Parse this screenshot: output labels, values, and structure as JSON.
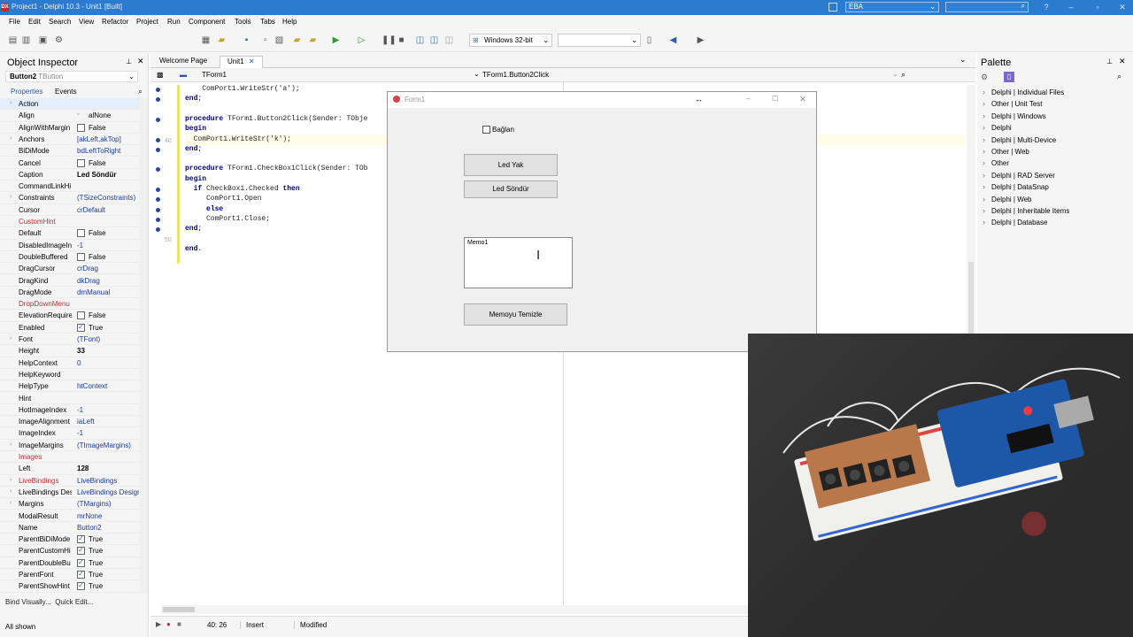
{
  "window": {
    "title": "Project1 - Delphi 10.3 - Unit1 [Built]",
    "app_badge": "DX",
    "desktop_combo": "EBA",
    "search_placeholder": ""
  },
  "menu": [
    "File",
    "Edit",
    "Search",
    "View",
    "Refactor",
    "Project",
    "Run",
    "Component",
    "Tools",
    "Tabs",
    "Help"
  ],
  "toolbar": {
    "platform": "Windows 32-bit",
    "config": ""
  },
  "object_inspector": {
    "title": "Object Inspector",
    "selected": "Button2",
    "selected_type": "TButton",
    "tabs": [
      "Properties",
      "Events"
    ],
    "properties": [
      {
        "name": "Action",
        "value": "",
        "exp": true,
        "style": "bold"
      },
      {
        "name": "Align",
        "value": "alNone"
      },
      {
        "name": "AlignWithMargin",
        "value": "False",
        "cb": false
      },
      {
        "name": "Anchors",
        "value": "[akLeft,akTop]",
        "exp": true
      },
      {
        "name": "BiDiMode",
        "value": "bdLeftToRight"
      },
      {
        "name": "Cancel",
        "value": "False",
        "cb": false
      },
      {
        "name": "Caption",
        "value": "Led Söndür",
        "vstyle": "bold"
      },
      {
        "name": "CommandLinkHi",
        "value": ""
      },
      {
        "name": "Constraints",
        "value": "(TSizeConstraints)",
        "exp": true
      },
      {
        "name": "Cursor",
        "value": "crDefault"
      },
      {
        "name": "CustomHint",
        "value": "",
        "nstyle": "red"
      },
      {
        "name": "Default",
        "value": "False",
        "cb": false
      },
      {
        "name": "DisabledImageIn",
        "value": "-1"
      },
      {
        "name": "DoubleBuffered",
        "value": "False",
        "cb": false
      },
      {
        "name": "DragCursor",
        "value": "crDrag"
      },
      {
        "name": "DragKind",
        "value": "dkDrag"
      },
      {
        "name": "DragMode",
        "value": "dmManual"
      },
      {
        "name": "DropDownMenu",
        "value": "",
        "nstyle": "red"
      },
      {
        "name": "ElevationRequire",
        "value": "False",
        "cb": false
      },
      {
        "name": "Enabled",
        "value": "True",
        "cb": true
      },
      {
        "name": "Font",
        "value": "(TFont)",
        "exp": true
      },
      {
        "name": "Height",
        "value": "33",
        "vstyle": "bold"
      },
      {
        "name": "HelpContext",
        "value": "0"
      },
      {
        "name": "HelpKeyword",
        "value": ""
      },
      {
        "name": "HelpType",
        "value": "htContext"
      },
      {
        "name": "Hint",
        "value": ""
      },
      {
        "name": "HotImageIndex",
        "value": "-1"
      },
      {
        "name": "ImageAlignment",
        "value": "iaLeft"
      },
      {
        "name": "ImageIndex",
        "value": "-1"
      },
      {
        "name": "ImageMargins",
        "value": "(TImageMargins)",
        "exp": true
      },
      {
        "name": "Images",
        "value": "",
        "nstyle": "red"
      },
      {
        "name": "Left",
        "value": "128",
        "vstyle": "bold"
      },
      {
        "name": "LiveBindings",
        "value": "LiveBindings",
        "exp": true,
        "nstyle": "red"
      },
      {
        "name": "LiveBindings Des",
        "value": "LiveBindings Design",
        "exp": true
      },
      {
        "name": "Margins",
        "value": "(TMargins)",
        "exp": true
      },
      {
        "name": "ModalResult",
        "value": "mrNone"
      },
      {
        "name": "Name",
        "value": "Button2"
      },
      {
        "name": "ParentBiDiMode",
        "value": "True",
        "cb": true
      },
      {
        "name": "ParentCustomHi",
        "value": "True",
        "cb": true
      },
      {
        "name": "ParentDoubleBu",
        "value": "True",
        "cb": true
      },
      {
        "name": "ParentFont",
        "value": "True",
        "cb": true
      },
      {
        "name": "ParentShowHint",
        "value": "True",
        "cb": true
      }
    ],
    "bind_visually": "Bind Visually...",
    "quick_edit": "Quick Edit...",
    "all_shown": "All shown"
  },
  "editor": {
    "tabs": [
      "Welcome Page",
      "Unit1"
    ],
    "class_combo": "TForm1",
    "method_combo": "TForm1.Button2Click",
    "line_number": "40",
    "line_number_50": "50",
    "status": {
      "pos": "40: 26",
      "mode": "Insert",
      "state": "Modified"
    }
  },
  "code": [
    {
      "t": "    ComPort1.WriteStr('a');"
    },
    {
      "t": "end;"
    },
    {
      "t": ""
    },
    {
      "t": "procedure TForm1.Button2Click(Sender: TObje"
    },
    {
      "t": "begin"
    },
    {
      "t": "  ComPort1.WriteStr('k');"
    },
    {
      "t": "end;"
    },
    {
      "t": ""
    },
    {
      "t": "procedure TForm1.CheckBox1Click(Sender: TOb"
    },
    {
      "t": "begin"
    },
    {
      "t": "  if CheckBox1.Checked then"
    },
    {
      "t": "     ComPort1.Open"
    },
    {
      "t": "     else"
    },
    {
      "t": "     ComPort1.Close;"
    },
    {
      "t": "end;"
    },
    {
      "t": ""
    },
    {
      "t": "end."
    }
  ],
  "form1": {
    "title": "Form1",
    "checkbox": "Bağlan",
    "btn1": "Led Yak",
    "btn2": "Led Söndür",
    "memo": "Memo1",
    "btn3": "Memoyu Temizle"
  },
  "palette": {
    "title": "Palette",
    "items": [
      "Delphi | Individual Files",
      "Other | Unit Test",
      "Delphi | Windows",
      "Delphi",
      "Delphi | Multi-Device",
      "Other | Web",
      "Other",
      "Delphi | RAD Server",
      "Delphi | DataSnap",
      "Delphi | Web",
      "Delphi | Inheritable Items",
      "Delphi | Database"
    ]
  }
}
